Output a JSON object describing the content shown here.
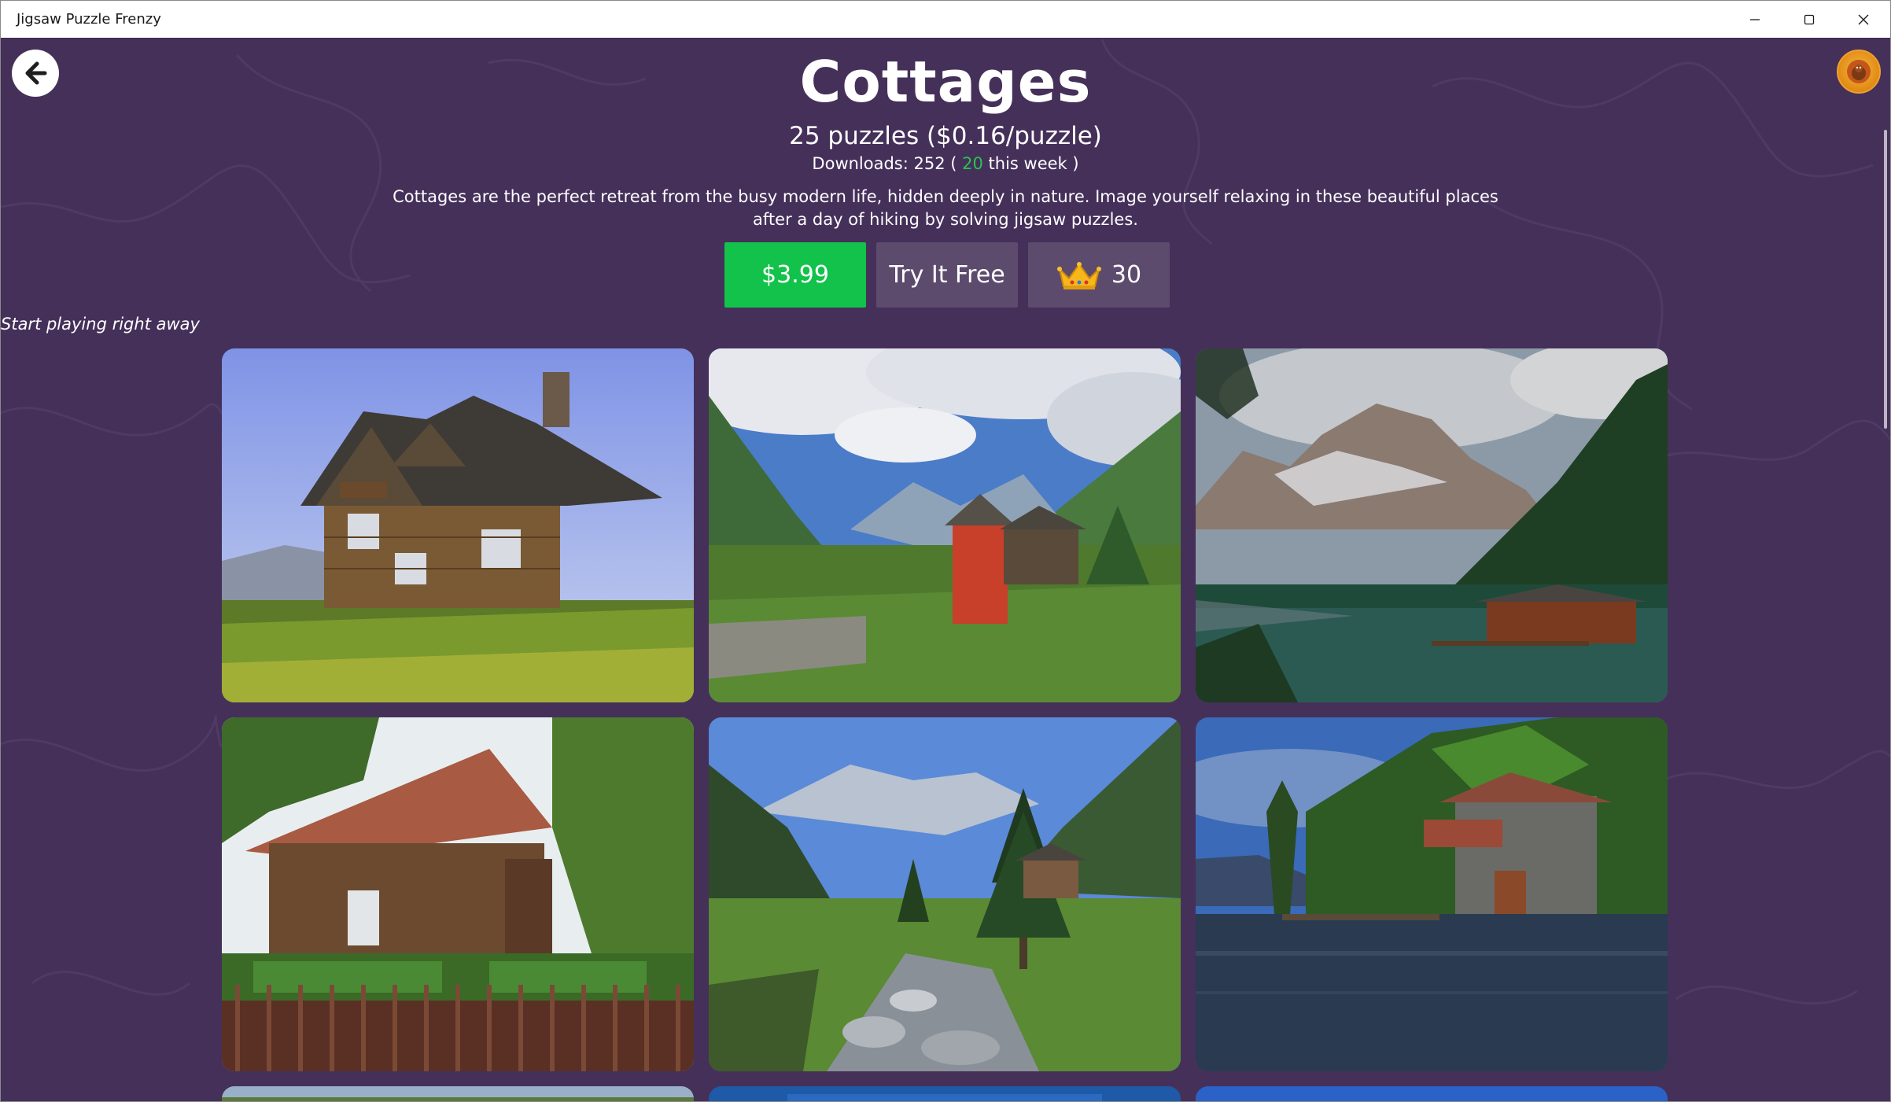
{
  "window": {
    "title": "Jigsaw Puzzle Frenzy",
    "controls": [
      "minimize",
      "maximize",
      "close"
    ]
  },
  "pack": {
    "title": "Cottages",
    "puzzle_count_text": "25 puzzles ($0.16/puzzle)",
    "downloads_prefix": "Downloads: 252 ( ",
    "downloads_week": "20",
    "downloads_suffix": " this week )",
    "description": "Cottages are the perfect retreat from the busy modern life, hidden deeply in nature. Image yourself relaxing in these beautiful places after a day of hiking by solving jigsaw puzzles.",
    "price_button": "$3.99",
    "try_free_button": "Try It Free",
    "crown_button": "30",
    "subtext": "Start playing right away"
  },
  "colors": {
    "background": "#45305a",
    "price_button": "#12c24a",
    "secondary_button": "#5d4b6e",
    "week_count": "#27c44f"
  },
  "puzzles": [
    {
      "name": "log-cottage-meadow"
    },
    {
      "name": "red-cabin-valley"
    },
    {
      "name": "lake-boathouse-mountains"
    },
    {
      "name": "wooden-cottage-garden"
    },
    {
      "name": "mountain-stream-cabin"
    },
    {
      "name": "stone-boathouse-lake"
    }
  ]
}
